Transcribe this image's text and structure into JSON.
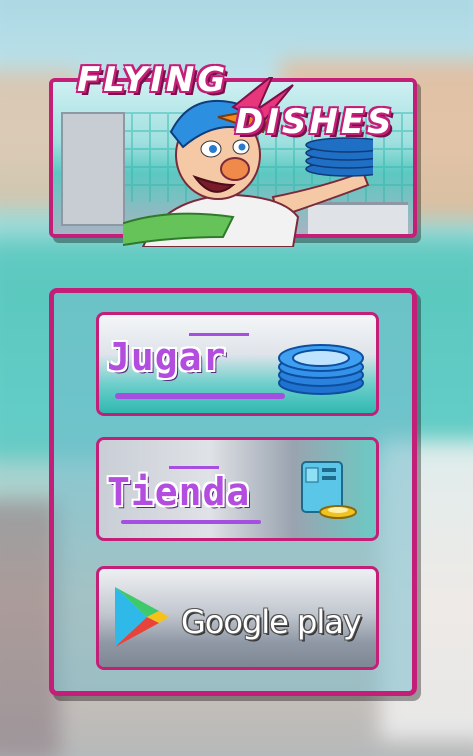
{
  "logo": {
    "title_word1": "FLYING",
    "title_word2": "DISHES"
  },
  "menu": {
    "play_label": "Jugar",
    "shop_label": "Tienda",
    "store_label": "Google play"
  },
  "colors": {
    "frame": "#c41f78",
    "label_purple": "#b34de0",
    "accent_blue": "#2c8fe0"
  },
  "icons": {
    "play": "plates-stack-icon",
    "shop": "dishwasher-icon",
    "store": "google-play-icon"
  }
}
